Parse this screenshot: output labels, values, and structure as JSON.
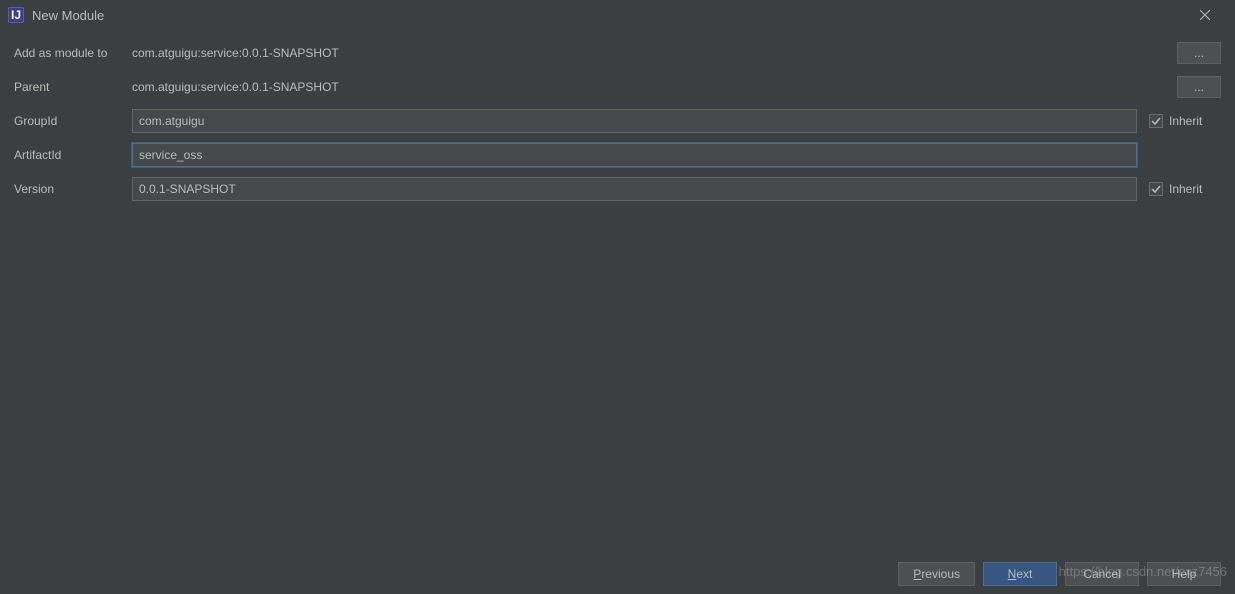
{
  "window": {
    "title": "New Module",
    "icon_label": "IJ"
  },
  "form": {
    "add_as_module": {
      "label": "Add as module to",
      "value": "com.atguigu:service:0.0.1-SNAPSHOT",
      "browse": "..."
    },
    "parent": {
      "label": "Parent",
      "value": "com.atguigu:service:0.0.1-SNAPSHOT",
      "browse": "..."
    },
    "group_id": {
      "label": "GroupId",
      "value": "com.atguigu",
      "inherit_label": "Inherit",
      "inherit_checked": true
    },
    "artifact_id": {
      "label": "ArtifactId",
      "value": "service_oss"
    },
    "version": {
      "label": "Version",
      "value": "0.0.1-SNAPSHOT",
      "inherit_label": "Inherit",
      "inherit_checked": true
    }
  },
  "buttons": {
    "previous": "Previous",
    "next": "Next",
    "cancel": "Cancel",
    "help": "Help"
  },
  "watermark": "https://blog.csdn.net/cxz7456"
}
